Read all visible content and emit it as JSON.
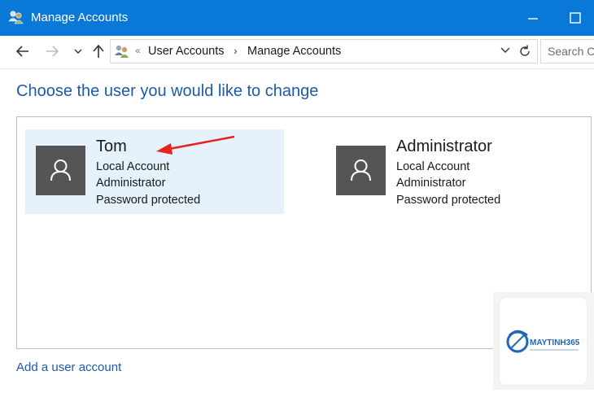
{
  "window": {
    "title": "Manage Accounts"
  },
  "nav": {
    "breadcrumbs": [
      "User Accounts",
      "Manage Accounts"
    ],
    "double_arrow": "«",
    "search_placeholder": "Search C"
  },
  "page": {
    "heading": "Choose the user you would like to change"
  },
  "accounts": [
    {
      "name": "Tom",
      "type": "Local Account",
      "role": "Administrator",
      "status": "Password protected",
      "selected": true
    },
    {
      "name": "Administrator",
      "type": "Local Account",
      "role": "Administrator",
      "status": "Password protected",
      "selected": false
    }
  ],
  "links": {
    "add_account": "Add a user account"
  },
  "watermark": {
    "brand_text": "MAYTINH365"
  },
  "colors": {
    "titlebar": "#0a78d7",
    "heading": "#1e5aa8",
    "selected_card": "#e5f1fb",
    "annotation_arrow": "#e8231f"
  }
}
